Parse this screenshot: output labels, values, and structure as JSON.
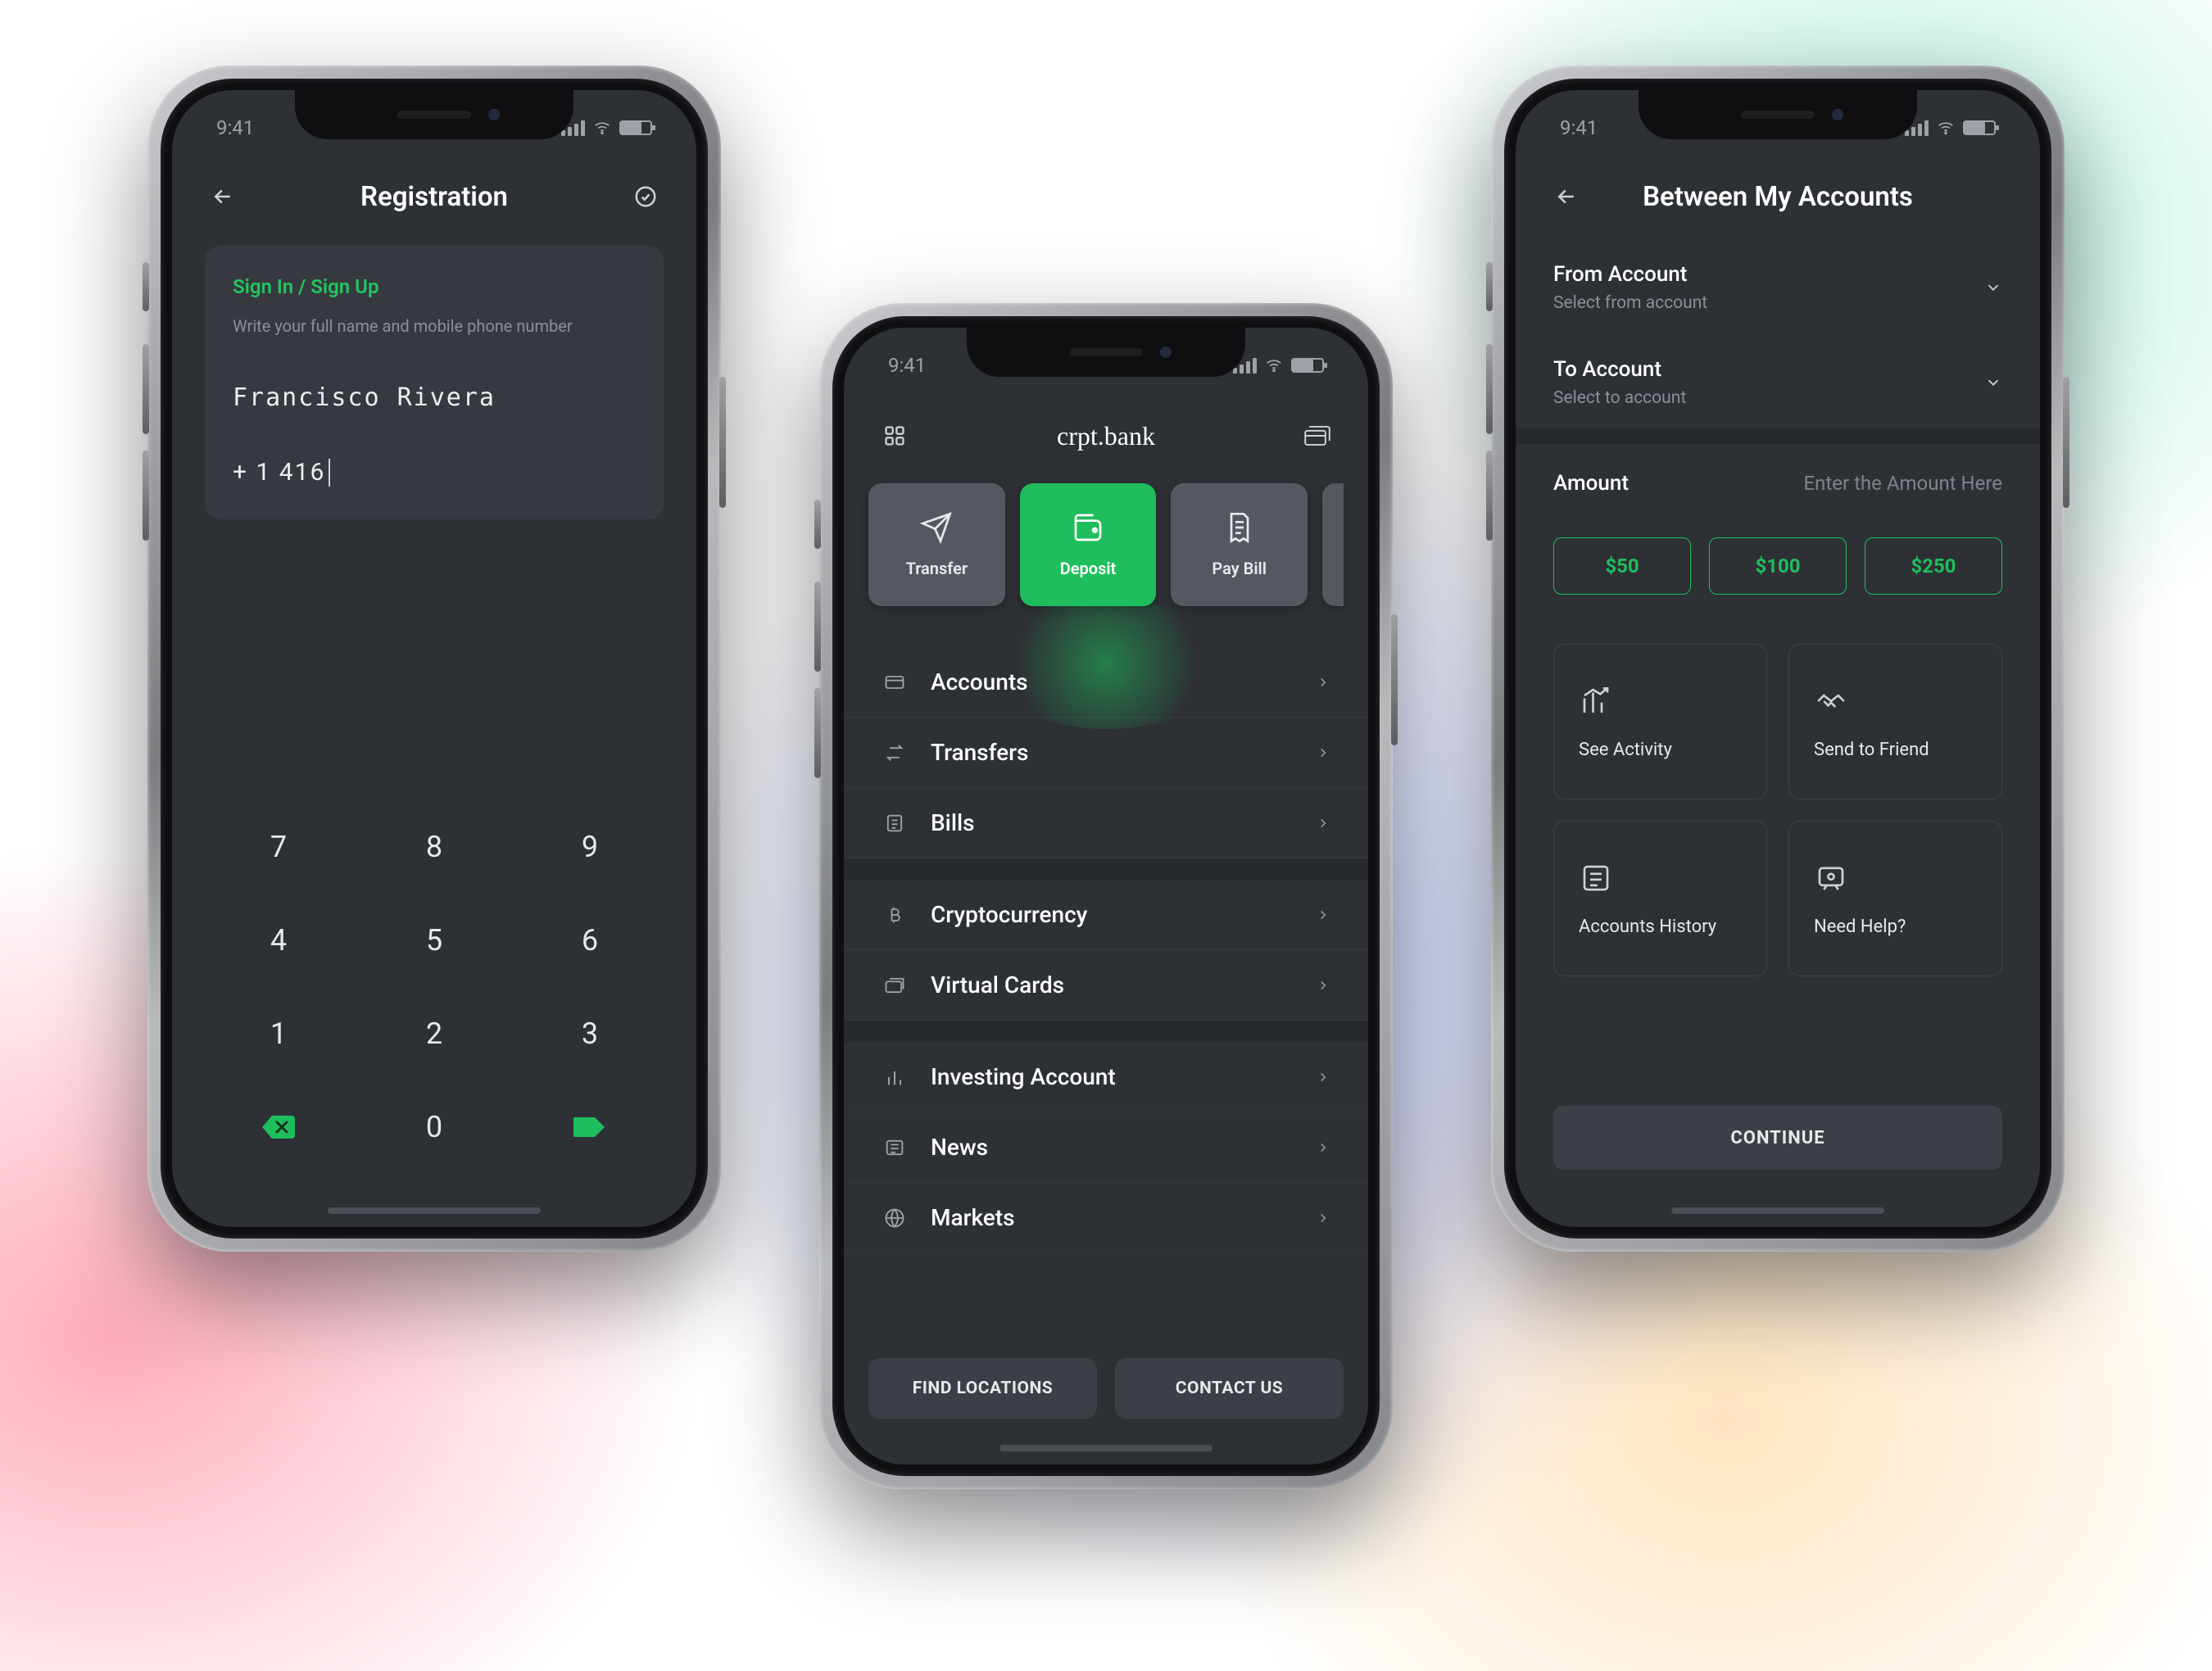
{
  "status": {
    "time": "9:41"
  },
  "screens": {
    "registration": {
      "title": "Registration",
      "sign_link": "Sign In / Sign Up",
      "hint": "Write your full name and mobile phone number",
      "name_value": "Francisco Rivera",
      "phone_value": "+ 1 416",
      "keypad": {
        "rows": [
          [
            "7",
            "8",
            "9"
          ],
          [
            "4",
            "5",
            "6"
          ],
          [
            "1",
            "2",
            "3"
          ]
        ],
        "zero": "0"
      }
    },
    "home": {
      "title": "crpt.bank",
      "quick": [
        {
          "key": "transfer",
          "label": "Transfer",
          "active": false
        },
        {
          "key": "deposit",
          "label": "Deposit",
          "active": true
        },
        {
          "key": "paybill",
          "label": "Pay Bill",
          "active": false
        }
      ],
      "menu_group1": [
        "Accounts",
        "Transfers",
        "Bills"
      ],
      "menu_group2": [
        "Cryptocurrency",
        "Virtual Cards"
      ],
      "menu_group3": [
        "Investing Account",
        "News",
        "Markets"
      ],
      "footer": {
        "find": "FIND LOCATIONS",
        "contact": "CONTACT US"
      }
    },
    "transfer": {
      "title": "Between My Accounts",
      "from": {
        "label": "From Account",
        "sub": "Select from account"
      },
      "to": {
        "label": "To Account",
        "sub": "Select to account"
      },
      "amount": {
        "label": "Amount",
        "placeholder": "Enter the  Amount Here"
      },
      "chips": [
        "$50",
        "$100",
        "$250"
      ],
      "tiles": [
        {
          "key": "activity",
          "label": "See Activity"
        },
        {
          "key": "send",
          "label": "Send to Friend"
        },
        {
          "key": "history",
          "label": "Accounts History"
        },
        {
          "key": "help",
          "label": "Need Help?"
        }
      ],
      "continue": "CONTINUE"
    }
  }
}
